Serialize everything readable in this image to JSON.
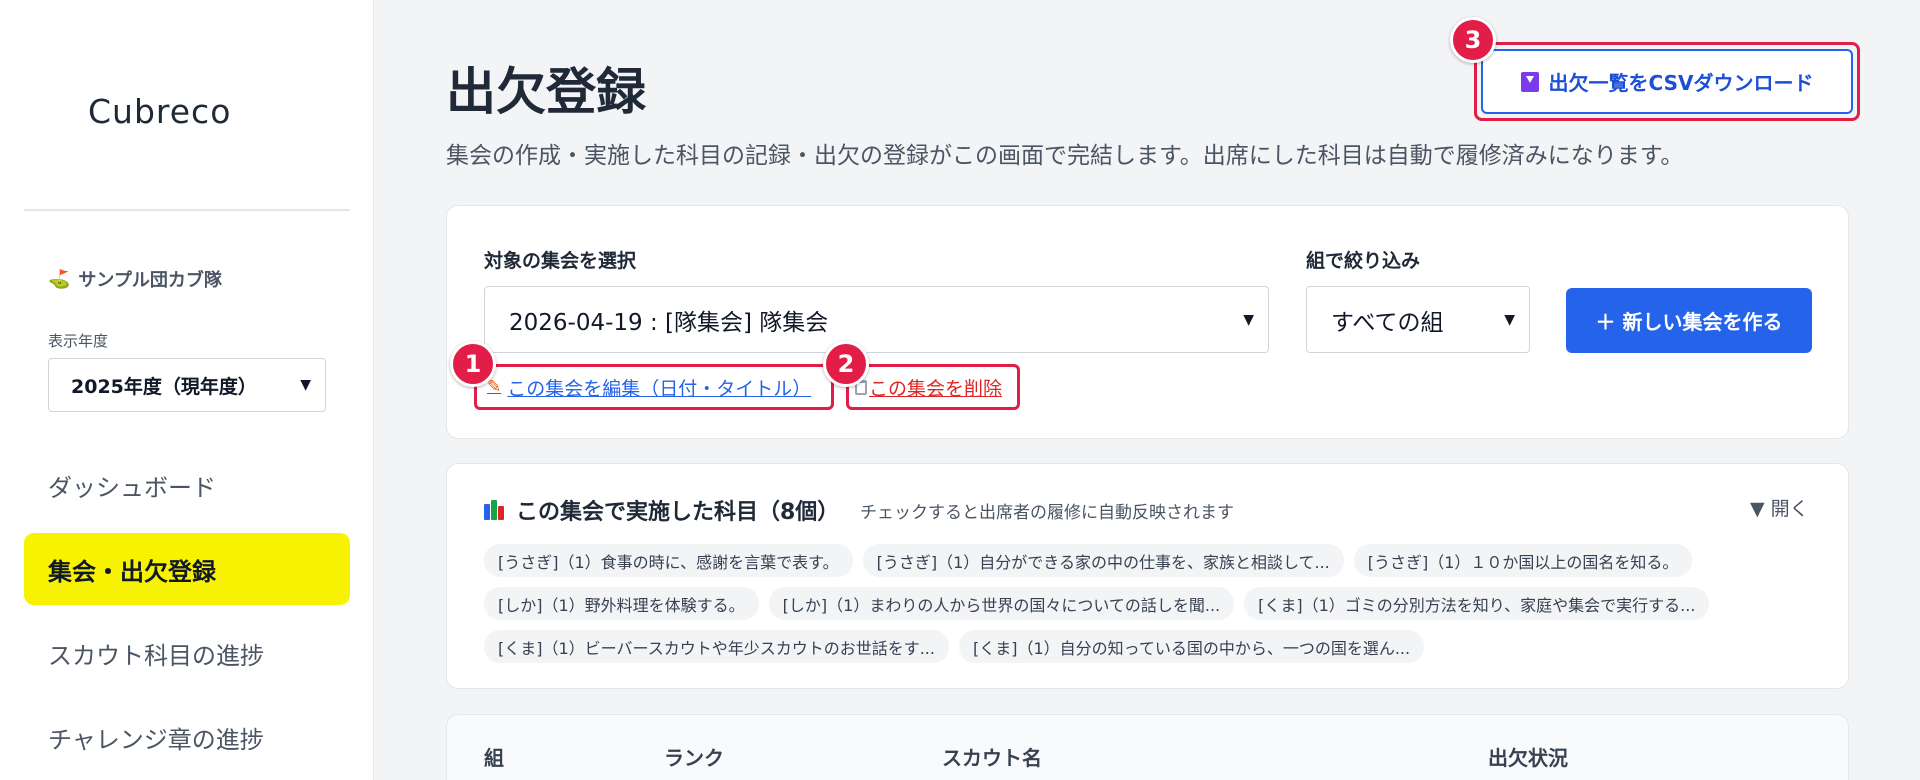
{
  "sidebar": {
    "logo": "Cubreco",
    "org_name": "サンプル団カブ隊",
    "year_label": "表示年度",
    "year_value": "2025年度（現年度）",
    "nav": [
      {
        "label": "ダッシュボード",
        "active": false
      },
      {
        "label": "集会・出欠登録",
        "active": true
      },
      {
        "label": "スカウト科目の進捗",
        "active": false
      },
      {
        "label": "チャレンジ章の進捗",
        "active": false
      }
    ]
  },
  "main": {
    "title": "出欠登録",
    "description": "集会の作成・実施した科目の記録・出欠の登録がこの画面で完結します。出席にした科目は自動で履修済みになります。",
    "csv_button": "出欠一覧をCSVダウンロード",
    "meeting_label": "対象の集会を選択",
    "meeting_value": "2026-04-19 : [隊集会] 隊集会",
    "group_label": "組で絞り込み",
    "group_value": "すべての組",
    "new_meeting_button": "＋ 新しい集会を作る",
    "edit_link": "この集会を編集（日付・タイトル）",
    "delete_link": "この集会を削除",
    "subjects_title": "この集会で実施した科目（8個）",
    "subjects_hint": "チェックすると出席者の履修に自動反映されます",
    "subjects_toggle": "▼ 開く",
    "subject_rows": [
      [
        "[うさぎ]（1）食事の時に、感謝を言葉で表す。",
        "[うさぎ]（1）自分ができる家の中の仕事を、家族と相談して...",
        "[うさぎ]（1）１０か国以上の国名を知る。"
      ],
      [
        "[しか]（1）野外料理を体験する。",
        "[しか]（1）まわりの人から世界の国々についての話しを聞...",
        "[くま]（1）ゴミの分別方法を知り、家庭や集会で実行する..."
      ],
      [
        "[くま]（1）ビーバースカウトや年少スカウトのお世話をす...",
        "[くま]（1）自分の知っている国の中から、一つの国を選ん..."
      ]
    ],
    "table_headers": {
      "group": "組",
      "rank": "ランク",
      "name": "スカウト名",
      "status": "出欠状況"
    }
  },
  "annotations": {
    "badge1": "1",
    "badge2": "2",
    "badge3": "3"
  },
  "colors": {
    "accent": "#2563eb",
    "highlight": "#f7f300",
    "annotation": "#e11d48",
    "danger": "#dc2626"
  }
}
